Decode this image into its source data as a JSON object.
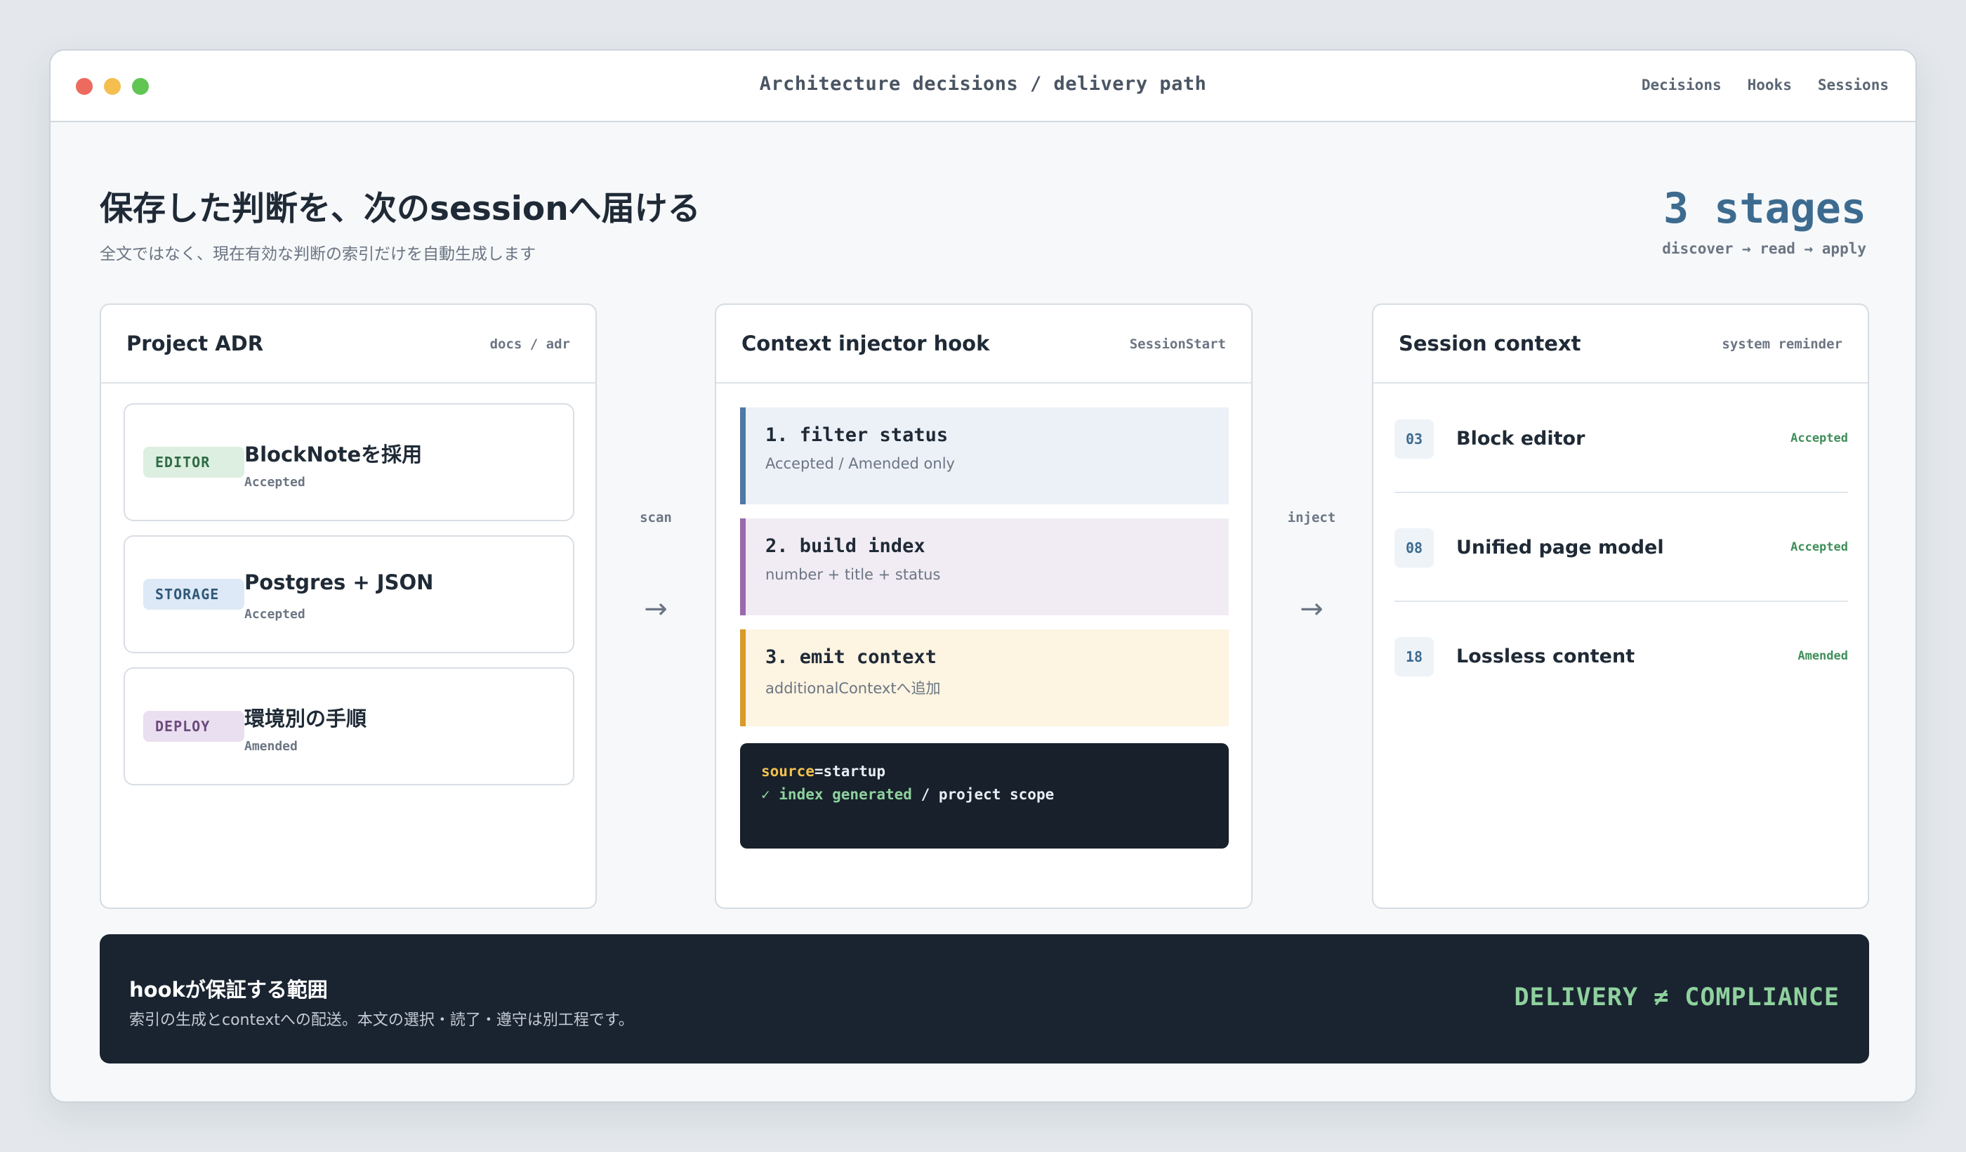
{
  "window": {
    "title": "Architecture decisions / delivery path",
    "nav": [
      "Decisions",
      "Hooks",
      "Sessions"
    ]
  },
  "hero": {
    "headline": "保存した判断を、次のsessionへ届ける",
    "subtitle": "全文ではなく、現在有効な判断の索引だけを自動生成します",
    "stages_value": "3 stages",
    "stages_flow": "discover → read → apply"
  },
  "panels": {
    "adr": {
      "title": "Project ADR",
      "tag": "docs / adr",
      "cards": [
        {
          "badge": "EDITOR",
          "title": "BlockNoteを採用",
          "status": "Accepted",
          "badge_bg": "#dcefe0",
          "badge_fg": "#2f6b45"
        },
        {
          "badge": "STORAGE",
          "title": "Postgres + JSON",
          "status": "Accepted",
          "badge_bg": "#dde9f6",
          "badge_fg": "#2f5877"
        },
        {
          "badge": "DEPLOY",
          "title": "環境別の手順",
          "status": "Amended",
          "badge_bg": "#eadff0",
          "badge_fg": "#6b4a7d"
        }
      ]
    },
    "hook": {
      "title": "Context injector hook",
      "tag": "SessionStart",
      "steps": [
        {
          "title": "1. filter status",
          "desc": "Accepted / Amended only",
          "bg": "#ecf1f8",
          "accent": "#4f78a3"
        },
        {
          "title": "2. build index",
          "desc": "number + title + status",
          "bg": "#f1ecf4",
          "accent": "#9a6aab"
        },
        {
          "title": "3. emit context",
          "desc": "additionalContextへ追加",
          "bg": "#fdf4e2",
          "accent": "#d89a2a"
        }
      ],
      "terminal": {
        "key": "source",
        "eq": "=",
        "value": "startup",
        "check": "✓ index generated",
        "rest": " / project scope"
      }
    },
    "session": {
      "title": "Session context",
      "tag": "system reminder",
      "rows": [
        {
          "num": "03",
          "title": "Block editor",
          "status": "Accepted"
        },
        {
          "num": "08",
          "title": "Unified page model",
          "status": "Accepted"
        },
        {
          "num": "18",
          "title": "Lossless content",
          "status": "Amended"
        }
      ]
    }
  },
  "connectors": {
    "scan": {
      "label": "scan",
      "arrow": "→"
    },
    "inject": {
      "label": "inject",
      "arrow": "→"
    }
  },
  "footer": {
    "title": "hookが保証する範囲",
    "desc": "索引の生成とcontextへの配送。本文の選択・読了・遵守は別工程です。",
    "tag": "DELIVERY ≠ COMPLIANCE"
  },
  "colors": {
    "accent": "#3d6b8f",
    "footer_bg": "#1a2430",
    "footer_tag": "#8fd19e",
    "status_green": "#3f8f5a",
    "term_key": "#f2c14e",
    "term_ok": "#8fd19e"
  }
}
